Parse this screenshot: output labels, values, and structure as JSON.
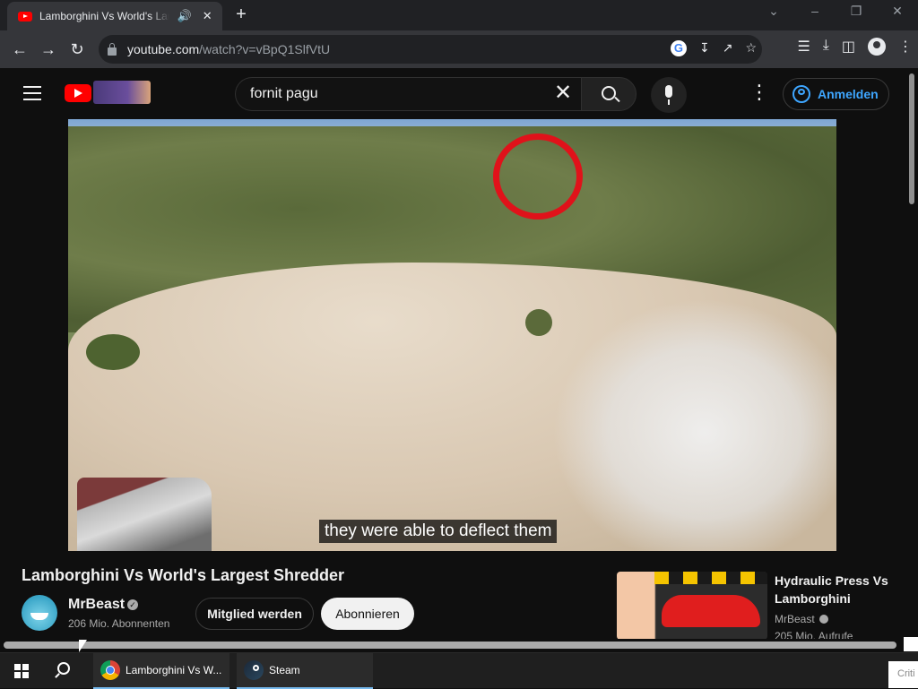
{
  "browser": {
    "tab_title": "Lamborghini Vs World's Largest Shredder",
    "url_domain": "youtube.com",
    "url_path": "/watch?v=vBpQ1SlfVtU"
  },
  "youtube": {
    "search_value": "fornit pagu",
    "signin_label": "Anmelden"
  },
  "video": {
    "subtitle": "they were able to deflect them",
    "title": "Lamborghini Vs World's Largest Shredder",
    "channel_name": "MrBeast",
    "subscribers": "206 Mio. Abonnenten",
    "join_label": "Mitglied werden",
    "subscribe_label": "Abonnieren"
  },
  "recommendation": {
    "title": "Hydraulic Press Vs Lamborghini",
    "channel": "MrBeast",
    "views": "205 Mio. Aufrufe"
  },
  "taskbar": {
    "apps": [
      {
        "label": "Lamborghini Vs W..."
      },
      {
        "label": "Steam"
      }
    ],
    "overflow_text": "Criti"
  },
  "colors": {
    "youtube_red": "#ff0000",
    "highlight_circle": "#e0121a",
    "link_blue": "#3ea6ff",
    "background": "#0f0f0f"
  }
}
